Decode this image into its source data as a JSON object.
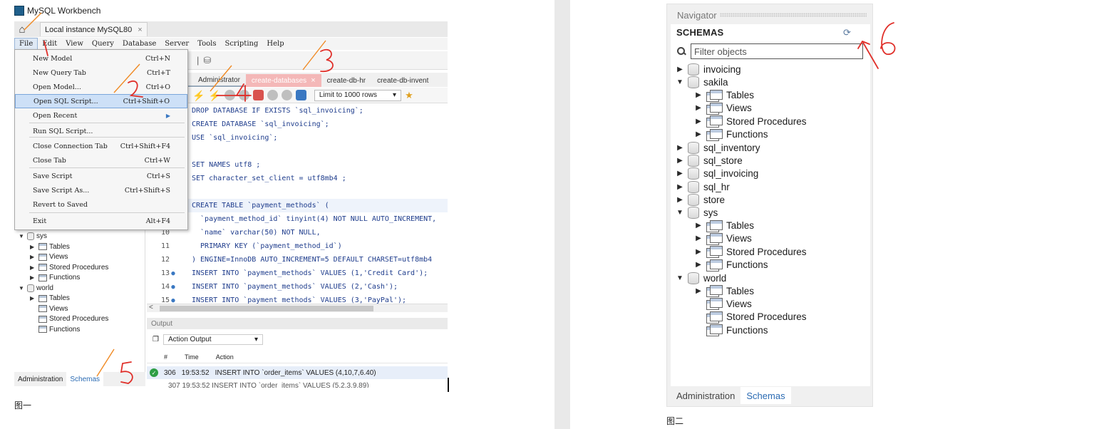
{
  "left": {
    "window_title": "MySQL Workbench",
    "connection_tab": "Local instance MySQL80",
    "menu": [
      "File",
      "Edit",
      "View",
      "Query",
      "Database",
      "Server",
      "Tools",
      "Scripting",
      "Help"
    ],
    "file_menu": [
      {
        "label": "New Model",
        "shortcut": "Ctrl+N"
      },
      {
        "label": "New Query Tab",
        "shortcut": "Ctrl+T"
      },
      {
        "label": "Open Model...",
        "shortcut": "Ctrl+O"
      },
      {
        "label": "Open SQL Script...",
        "shortcut": "Ctrl+Shift+O"
      },
      {
        "label": "Open Recent",
        "shortcut": ""
      },
      {
        "label": "Run SQL Script...",
        "shortcut": ""
      },
      {
        "label": "Close Connection Tab",
        "shortcut": "Ctrl+Shift+F4"
      },
      {
        "label": "Close Tab",
        "shortcut": "Ctrl+W"
      },
      {
        "label": "Save Script",
        "shortcut": "Ctrl+S"
      },
      {
        "label": "Save Script As...",
        "shortcut": "Ctrl+Shift+S"
      },
      {
        "label": "Revert to Saved",
        "shortcut": ""
      },
      {
        "label": "Exit",
        "shortcut": "Alt+F4"
      }
    ],
    "editor_tabs": [
      "Administrator",
      "create-databases",
      "create-db-hr",
      "create-db-invent"
    ],
    "limit_rows": "Limit to 1000 rows",
    "code_lines": [
      {
        "num": "",
        "text": "DROP DATABASE IF EXISTS `sql_invoicing`;"
      },
      {
        "num": "",
        "text": "CREATE DATABASE `sql_invoicing`;"
      },
      {
        "num": "",
        "text": "USE `sql_invoicing`;"
      },
      {
        "num": "",
        "text": ""
      },
      {
        "num": "",
        "text": "SET NAMES utf8 ;"
      },
      {
        "num": "",
        "text": "SET character_set_client = utf8mb4 ;"
      },
      {
        "num": "",
        "text": ""
      },
      {
        "num": "",
        "text": "CREATE TABLE `payment_methods` ("
      },
      {
        "num": "",
        "text": "  `payment_method_id` tinyint(4) NOT NULL AUTO_INCREMENT,"
      },
      {
        "num": "10",
        "text": "  `name` varchar(50) NOT NULL,"
      },
      {
        "num": "11",
        "text": "  PRIMARY KEY (`payment_method_id`)"
      },
      {
        "num": "12",
        "text": ") ENGINE=InnoDB AUTO_INCREMENT=5 DEFAULT CHARSET=utf8mb4"
      },
      {
        "num": "13",
        "text": "INSERT INTO `payment_methods` VALUES (1,'Credit Card');"
      },
      {
        "num": "14",
        "text": "INSERT INTO `payment_methods` VALUES (2,'Cash');"
      },
      {
        "num": "15",
        "text": "INSERT INTO `payment_methods` VALUES (3,'PayPal');"
      }
    ],
    "output_title": "Output",
    "output_select": "Action Output",
    "output_cols": [
      "#",
      "Time",
      "Action"
    ],
    "output_row": {
      "num": "306",
      "time": "19:53:52",
      "action": "INSERT INTO `order_items` VALUES (4,10,7,6.40)"
    },
    "output_row2": "307  19:53:52  INSERT INTO `order_items` VALUES (5,2,3,9.89)",
    "nav_tree": [
      {
        "label": "sys",
        "level": 0
      },
      {
        "label": "Tables",
        "level": 1
      },
      {
        "label": "Views",
        "level": 1
      },
      {
        "label": "Stored Procedures",
        "level": 1
      },
      {
        "label": "Functions",
        "level": 1
      },
      {
        "label": "world",
        "level": 0
      },
      {
        "label": "Tables",
        "level": 1
      },
      {
        "label": "Views",
        "level": 1
      },
      {
        "label": "Stored Procedures",
        "level": 1
      },
      {
        "label": "Functions",
        "level": 1
      }
    ],
    "bottom_tabs": [
      "Administration",
      "Schemas"
    ],
    "caption": "图一"
  },
  "right": {
    "navigator_title": "Navigator",
    "schemas_label": "SCHEMAS",
    "filter_placeholder": "Filter objects",
    "tree": [
      {
        "label": "invoicing",
        "type": "db",
        "expanded": false
      },
      {
        "label": "sakila",
        "type": "db",
        "expanded": true
      },
      {
        "label": "Tables",
        "type": "folder",
        "expanded": false
      },
      {
        "label": "Views",
        "type": "folder",
        "expanded": false
      },
      {
        "label": "Stored Procedures",
        "type": "folder",
        "expanded": false
      },
      {
        "label": "Functions",
        "type": "folder",
        "expanded": false
      },
      {
        "label": "sql_inventory",
        "type": "db",
        "expanded": false
      },
      {
        "label": "sql_store",
        "type": "db",
        "expanded": false
      },
      {
        "label": "sql_invoicing",
        "type": "db",
        "expanded": false
      },
      {
        "label": "sql_hr",
        "type": "db",
        "expanded": false
      },
      {
        "label": "store",
        "type": "db",
        "expanded": false
      },
      {
        "label": "sys",
        "type": "db",
        "expanded": true
      },
      {
        "label": "Tables",
        "type": "folder",
        "expanded": false
      },
      {
        "label": "Views",
        "type": "folder",
        "expanded": false
      },
      {
        "label": "Stored Procedures",
        "type": "folder",
        "expanded": false
      },
      {
        "label": "Functions",
        "type": "folder",
        "expanded": false
      },
      {
        "label": "world",
        "type": "db",
        "expanded": true
      },
      {
        "label": "Tables",
        "type": "folder",
        "expanded": false
      },
      {
        "label": "Views",
        "type": "folder",
        "expanded": null
      },
      {
        "label": "Stored Procedures",
        "type": "folder",
        "expanded": null
      },
      {
        "label": "Functions",
        "type": "folder",
        "expanded": null
      }
    ],
    "bottom_tabs": [
      "Administration",
      "Schemas"
    ],
    "caption": "图二"
  },
  "annotations": [
    "1",
    "2",
    "3",
    "4",
    "5",
    "6"
  ],
  "colors": {
    "annotation": "#e0302a",
    "arrow": "#f08a24",
    "link_blue": "#2b6bb3",
    "sql_keyword": "#1e3c8c"
  }
}
